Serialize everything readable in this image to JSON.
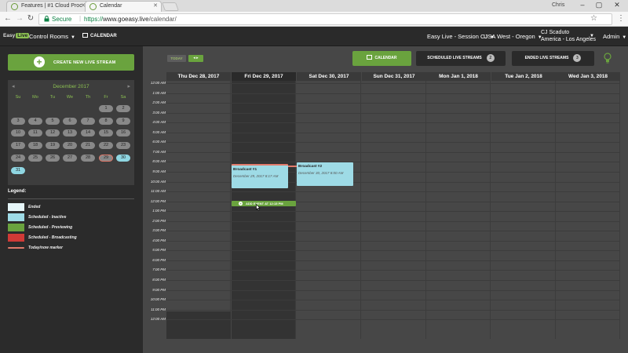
{
  "browser": {
    "tabs": [
      {
        "title": "Features | #1 Cloud Proc",
        "active": false
      },
      {
        "title": "Calendar",
        "active": true
      }
    ],
    "user_badge": "Chris",
    "secure_label": "Secure",
    "url_scheme": "https://",
    "url_host": "www.goeasy.live",
    "url_path": "/calendar/"
  },
  "app": {
    "logo_prefix": "Easy",
    "logo_suffix": "Live",
    "nav_control_rooms": "Control Rooms",
    "nav_calendar": "CALENDAR",
    "session_selector": "Easy Live - Session CJ",
    "region_selector": "USA West - Oregon",
    "user_name": "CJ Scaduto",
    "user_timezone": "America - Los Angeles",
    "admin_menu": "Admin"
  },
  "sidebar": {
    "create_button": "CREATE NEW LIVE STREAM",
    "mini_calendar": {
      "month_label": "December 2017",
      "days_of_week": [
        "Su",
        "Mo",
        "Tu",
        "We",
        "Th",
        "Fr",
        "Sa"
      ],
      "weeks": [
        [
          "",
          "",
          "",
          "",
          "",
          "1",
          "2"
        ],
        [
          "3",
          "4",
          "5",
          "6",
          "7",
          "8",
          "9"
        ],
        [
          "10",
          "11",
          "12",
          "13",
          "14",
          "15",
          "16"
        ],
        [
          "17",
          "18",
          "19",
          "20",
          "21",
          "22",
          "23"
        ],
        [
          "24",
          "25",
          "26",
          "27",
          "28",
          "29",
          "30"
        ],
        [
          "31",
          "",
          "",
          "",
          "",
          "",
          ""
        ]
      ],
      "today": "29",
      "highlighted": [
        "30",
        "31"
      ]
    },
    "legend_title": "Legend:",
    "legend": [
      {
        "label": "Ended",
        "color": "#e6f6f8"
      },
      {
        "label": "Scheduled - Inactive",
        "color": "#9edbe6"
      },
      {
        "label": "Scheduled - Previewing",
        "color": "#6aa33e"
      },
      {
        "label": "Scheduled - Broadcasting",
        "color": "#d03a36"
      },
      {
        "label": "Today/now marker",
        "color": "#e07a6b"
      }
    ]
  },
  "toolbar": {
    "today_button": "TODAY",
    "nav_arrows": "◂ ▸",
    "calendar_tab": "CALENDAR",
    "scheduled_tab": "SCHEDULED LIVE STREAMS",
    "scheduled_count": "2",
    "ended_tab": "ENDED LIVE STREAMS",
    "ended_count": "3"
  },
  "week": {
    "days": [
      "Thu Dec 28, 2017",
      "Fri Dec 29, 2017",
      "Sat Dec 30, 2017",
      "Sun Dec 31, 2017",
      "Mon Jan 1, 2018",
      "Tue Jan 2, 2018",
      "Wed Jan 3, 2018"
    ],
    "time_labels": [
      "12:00 AM",
      "1:00 AM",
      "2:00 AM",
      "3:00 AM",
      "4:00 AM",
      "5:00 AM",
      "6:00 AM",
      "7:00 AM",
      "8:00 AM",
      "9:00 AM",
      "10:00 AM",
      "11:00 AM",
      "12:00 PM",
      "1:00 PM",
      "2:00 PM",
      "3:00 PM",
      "4:00 PM",
      "5:00 PM",
      "6:00 PM",
      "7:00 PM",
      "8:00 PM",
      "9:00 PM",
      "10:00 PM",
      "11:00 PM",
      "12:00 AM"
    ],
    "events": [
      {
        "title": "Broadcast #1",
        "subtitle": "December 29, 2017 8:17 AM"
      },
      {
        "title": "Broadcast #2",
        "subtitle": "December 30, 2017 8:00 AM"
      }
    ],
    "add_event_label": "ADD EVENT AT 12:15 PM"
  },
  "colors": {
    "accent_green": "#6aa33e",
    "inactive_blue": "#9edbe6",
    "now_marker": "#e07a6b"
  }
}
